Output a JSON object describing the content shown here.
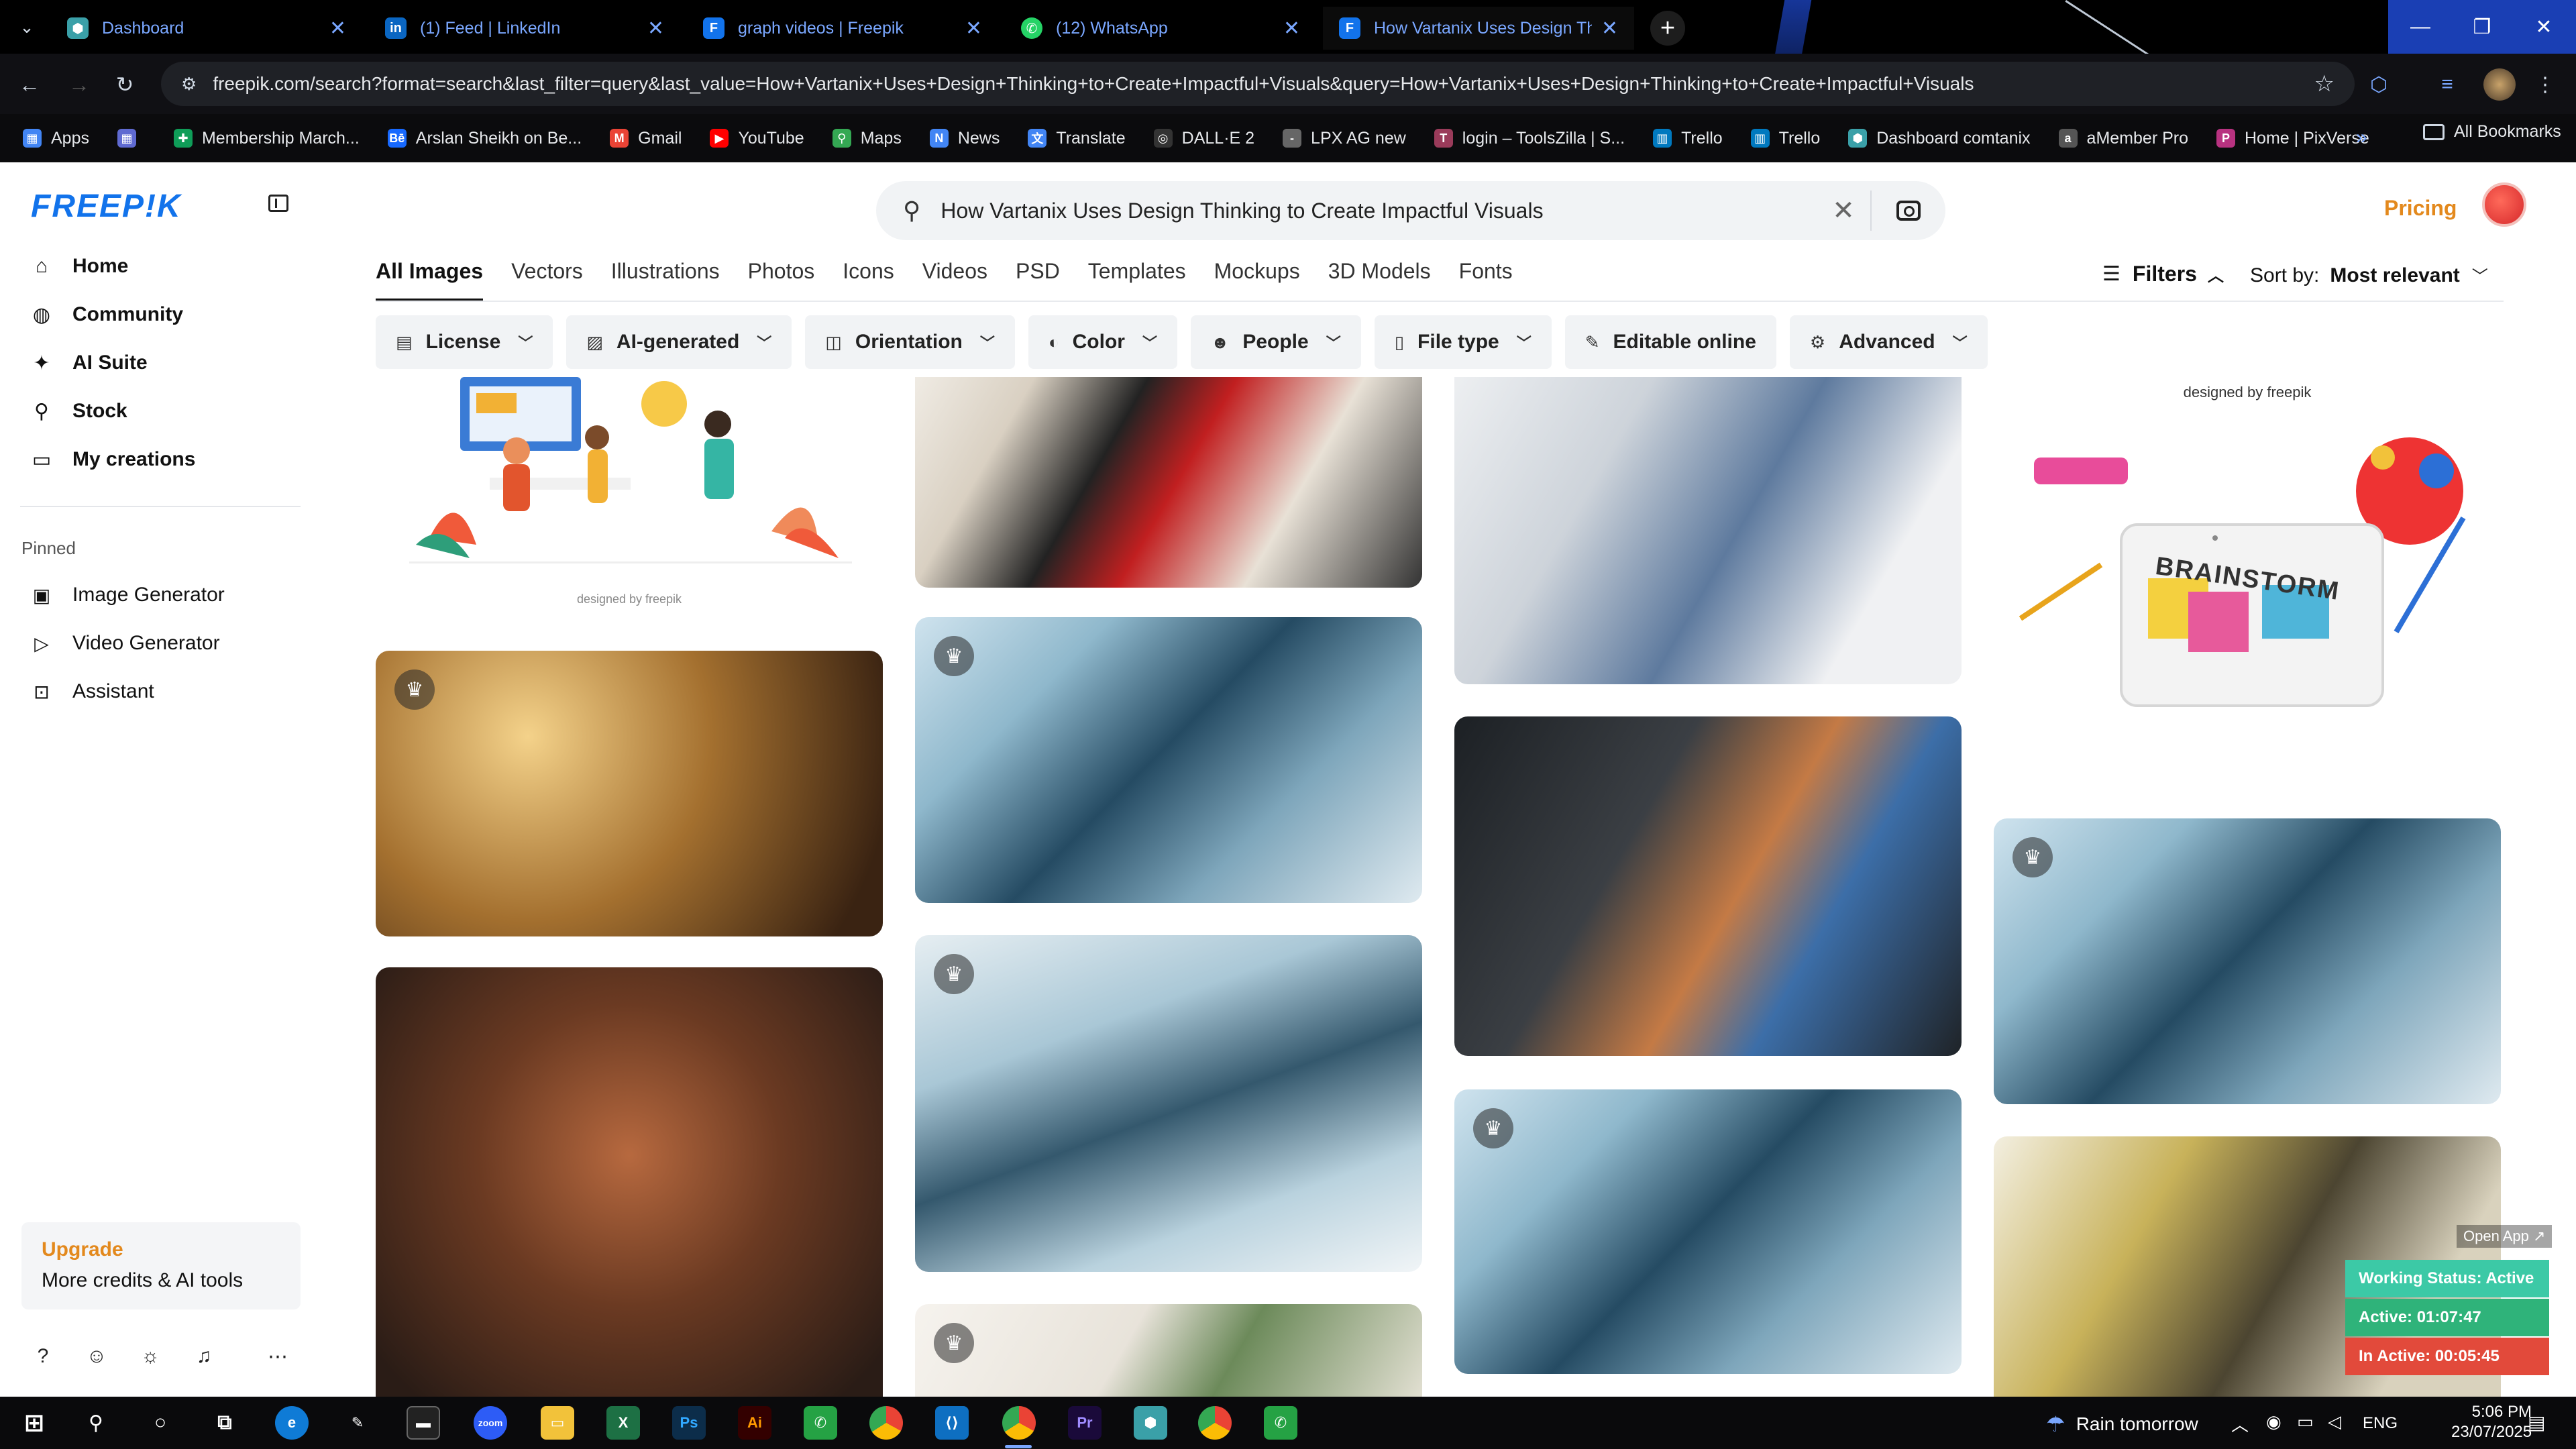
{
  "browser": {
    "tabs": [
      {
        "title": "Dashboard",
        "icon": "hexagon-icon",
        "color": "#3aa0a8"
      },
      {
        "title": "(1) Feed | LinkedIn",
        "icon": "linkedin-icon",
        "color": "#0a66c2"
      },
      {
        "title": "graph videos | Freepik",
        "icon": "freepik-icon",
        "color": "#1273eb"
      },
      {
        "title": "(12) WhatsApp",
        "icon": "whatsapp-icon",
        "color": "#25d366"
      },
      {
        "title": "How Vartanix Uses Design Thin",
        "icon": "freepik-icon",
        "color": "#1273eb"
      }
    ],
    "url": "freepik.com/search?format=search&last_filter=query&last_value=How+Vartanix+Uses+Design+Thinking+to+Create+Impactful+Visuals&query=How+Vartanix+Uses+Design+Thinking+to+Create+Impactful+Visuals",
    "bookmarks": [
      {
        "label": "Apps",
        "color": "#4285f4"
      },
      {
        "label": "",
        "color": "#5f6ad1"
      },
      {
        "label": "Membership March...",
        "color": "#0f9d58"
      },
      {
        "label": "Arslan Sheikh on Be...",
        "color": "#1769ff"
      },
      {
        "label": "Gmail",
        "color": "#ea4335"
      },
      {
        "label": "YouTube",
        "color": "#ff0000"
      },
      {
        "label": "Maps",
        "color": "#34a853"
      },
      {
        "label": "News",
        "color": "#4285f4"
      },
      {
        "label": "Translate",
        "color": "#4285f4"
      },
      {
        "label": "DALL·E 2",
        "color": "#333333"
      },
      {
        "label": "LPX AG new",
        "color": "#666666"
      },
      {
        "label": "login – ToolsZilla | S...",
        "color": "#9a3b5a"
      },
      {
        "label": "Trello",
        "color": "#0079bf"
      },
      {
        "label": "Trello",
        "color": "#0079bf"
      },
      {
        "label": "Dashboard comtanix",
        "color": "#3aa0a8"
      },
      {
        "label": "aMember Pro",
        "color": "#555555"
      },
      {
        "label": "Home | PixVerse",
        "color": "#b83280"
      }
    ],
    "all_bookmarks": "All Bookmarks"
  },
  "sidebar": {
    "logo": "FREEP!K",
    "nav": [
      {
        "label": "Home",
        "icon": "home-icon"
      },
      {
        "label": "Community",
        "icon": "globe-icon"
      },
      {
        "label": "AI Suite",
        "icon": "sparkle-icon"
      },
      {
        "label": "Stock",
        "icon": "search-icon"
      },
      {
        "label": "My creations",
        "icon": "folder-icon"
      }
    ],
    "pinned_label": "Pinned",
    "pinned": [
      {
        "label": "Image Generator",
        "icon": "image-icon"
      },
      {
        "label": "Video Generator",
        "icon": "video-icon"
      },
      {
        "label": "Assistant",
        "icon": "assistant-icon"
      }
    ],
    "upgrade": {
      "title": "Upgrade",
      "subtitle": "More credits & AI tools"
    }
  },
  "search": {
    "query": "How Vartanix Uses Design Thinking to Create Impactful Visuals"
  },
  "header": {
    "pricing": "Pricing"
  },
  "categories": [
    "All Images",
    "Vectors",
    "Illustrations",
    "Photos",
    "Icons",
    "Videos",
    "PSD",
    "Templates",
    "Mockups",
    "3D Models",
    "Fonts"
  ],
  "filters_label": "Filters",
  "sort": {
    "label": "Sort by:",
    "value": "Most relevant"
  },
  "chips": [
    {
      "label": "License",
      "icon": "license-icon"
    },
    {
      "label": "AI-generated",
      "icon": "ai-icon"
    },
    {
      "label": "Orientation",
      "icon": "orientation-icon"
    },
    {
      "label": "Color",
      "icon": "palette-icon"
    },
    {
      "label": "People",
      "icon": "people-icon"
    },
    {
      "label": "File type",
      "icon": "file-icon"
    },
    {
      "label": "Editable online",
      "icon": "pen-icon"
    },
    {
      "label": "Advanced",
      "icon": "gear-icon"
    }
  ],
  "grid": {
    "credit_small": "designed by freepik",
    "credit_top": "designed by freepik",
    "brainstorm": "BRAINSTORM"
  },
  "overlay": {
    "open_app": "Open App ↗",
    "working_status": "Working Status: Active",
    "active": "Active: 01:07:47",
    "inactive": "In Active: 00:05:45",
    "colors": {
      "status": "#3cc9a6",
      "active": "#2fb37a",
      "inactive": "#e24a3b"
    }
  },
  "taskbar": {
    "weather": "Rain tomorrow",
    "lang": "ENG",
    "time": "5:06 PM",
    "date": "23/07/2025"
  }
}
